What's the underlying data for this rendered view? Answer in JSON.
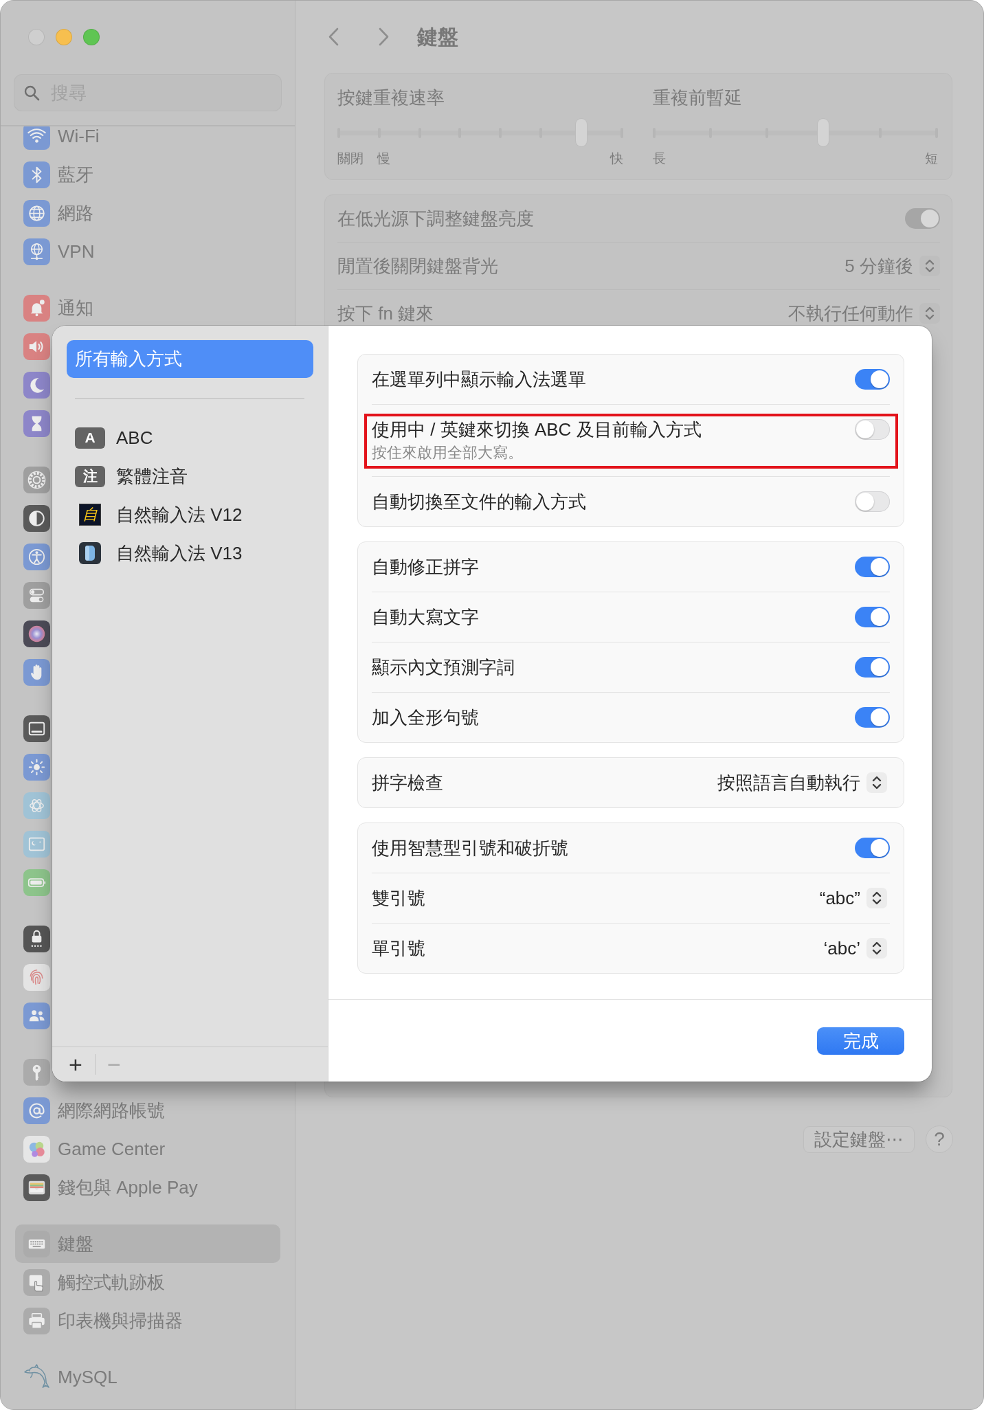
{
  "window": {
    "controls": [
      {
        "kind": "close",
        "disabled": true
      },
      {
        "kind": "minimize",
        "disabled": false
      },
      {
        "kind": "zoom",
        "disabled": false
      }
    ]
  },
  "sidebar": {
    "search": {
      "placeholder": "搜尋"
    },
    "groups": [
      {
        "items": [
          {
            "label": "Wi-Fi",
            "selected": false
          },
          {
            "label": "藍牙",
            "selected": false
          },
          {
            "label": "網路",
            "selected": false
          },
          {
            "label": "VPN",
            "selected": false
          }
        ]
      },
      {
        "items": [
          {
            "label": "通知",
            "selected": false
          },
          {
            "selected": false
          },
          {
            "selected": false
          },
          {
            "selected": false
          }
        ]
      },
      {
        "items": [
          {
            "selected": false
          },
          {
            "selected": false
          },
          {
            "selected": false
          },
          {
            "selected": false
          },
          {
            "selected": false
          },
          {
            "selected": false
          }
        ]
      },
      {
        "items": [
          {
            "selected": false
          },
          {
            "selected": false
          },
          {
            "selected": false
          },
          {
            "selected": false
          },
          {
            "selected": false
          }
        ]
      },
      {
        "items": [
          {
            "selected": false
          },
          {
            "selected": false
          },
          {
            "selected": false
          }
        ]
      },
      {
        "items": [
          {
            "selected": false
          },
          {
            "label": "網際網路帳號",
            "selected": false
          },
          {
            "label": "Game Center",
            "selected": false
          },
          {
            "label": "錢包與 Apple Pay",
            "selected": false
          }
        ]
      },
      {
        "items": [
          {
            "label": "鍵盤",
            "selected": true
          },
          {
            "label": "觸控式軌跡板",
            "selected": false
          },
          {
            "label": "印表機與掃描器",
            "selected": false
          }
        ]
      },
      {
        "items": [
          {
            "label": "MySQL",
            "selected": false
          }
        ]
      }
    ]
  },
  "toolbar": {
    "title": "鍵盤"
  },
  "repeat_card": {
    "sliders": [
      {
        "title": "按鍵重複速率",
        "level": 0.857,
        "min_labels": [
          "關閉",
          "慢"
        ],
        "max_label": "快"
      },
      {
        "title": "重複前暫延",
        "level": 0.6,
        "min_labels": [
          "長"
        ],
        "max_label": "短"
      }
    ]
  },
  "backlight_card": {
    "rows": [
      {
        "kind": "toggle",
        "label": "在低光源下調整鍵盤亮度",
        "on": true
      },
      {
        "kind": "popup",
        "label": "閒置後關閉鍵盤背光",
        "value": "5 分鐘後"
      },
      {
        "kind": "popup",
        "label": "按下 fn 鍵來",
        "value": "不執行任何動作"
      }
    ]
  },
  "footer": {
    "buttons": [
      {
        "label": "設定鍵盤⋯"
      }
    ],
    "help": "?"
  },
  "sheet": {
    "sources": [
      {
        "kind": "all",
        "label": "所有輸入方式",
        "selected": true
      },
      {
        "kind": "badge",
        "badge": "A",
        "label": "ABC",
        "selected": false
      },
      {
        "kind": "badge",
        "badge": "注",
        "label": "繁體注音",
        "selected": false
      },
      {
        "kind": "glyph-app",
        "badge": "自",
        "label": "自然輸入法 V12",
        "selected": false
      },
      {
        "kind": "app",
        "label": "自然輸入法 V13",
        "selected": false
      }
    ],
    "list_buttons": [
      {
        "label": "+",
        "disabled": false
      },
      {
        "label": "−",
        "disabled": true
      }
    ],
    "groups": [
      {
        "rows": [
          {
            "kind": "toggle",
            "label": "在選單列中顯示輸入法選單",
            "on": true,
            "highlighted": false
          },
          {
            "kind": "toggle",
            "label": "使用中 / 英鍵來切換 ABC 及目前輸入方式",
            "note": "按住來啟用全部大寫。",
            "on": false,
            "highlighted": true
          },
          {
            "kind": "toggle",
            "label": "自動切換至文件的輸入方式",
            "on": false,
            "highlighted": false
          }
        ]
      },
      {
        "rows": [
          {
            "kind": "toggle",
            "label": "自動修正拼字",
            "on": true,
            "highlighted": false
          },
          {
            "kind": "toggle",
            "label": "自動大寫文字",
            "on": true,
            "highlighted": false
          },
          {
            "kind": "toggle",
            "label": "顯示內文預測字詞",
            "on": true,
            "highlighted": false
          },
          {
            "kind": "toggle",
            "label": "加入全形句號",
            "on": true,
            "highlighted": false
          }
        ]
      },
      {
        "rows": [
          {
            "kind": "popup",
            "label": "拼字檢查",
            "value": "按照語言自動執行",
            "highlighted": false
          }
        ]
      },
      {
        "rows": [
          {
            "kind": "toggle",
            "label": "使用智慧型引號和破折號",
            "on": true,
            "highlighted": false
          },
          {
            "kind": "popup",
            "label": "雙引號",
            "value": "“abc”",
            "highlighted": false
          },
          {
            "kind": "popup",
            "label": "單引號",
            "value": "‘abc’",
            "highlighted": false
          }
        ]
      }
    ],
    "done_button": "完成"
  }
}
